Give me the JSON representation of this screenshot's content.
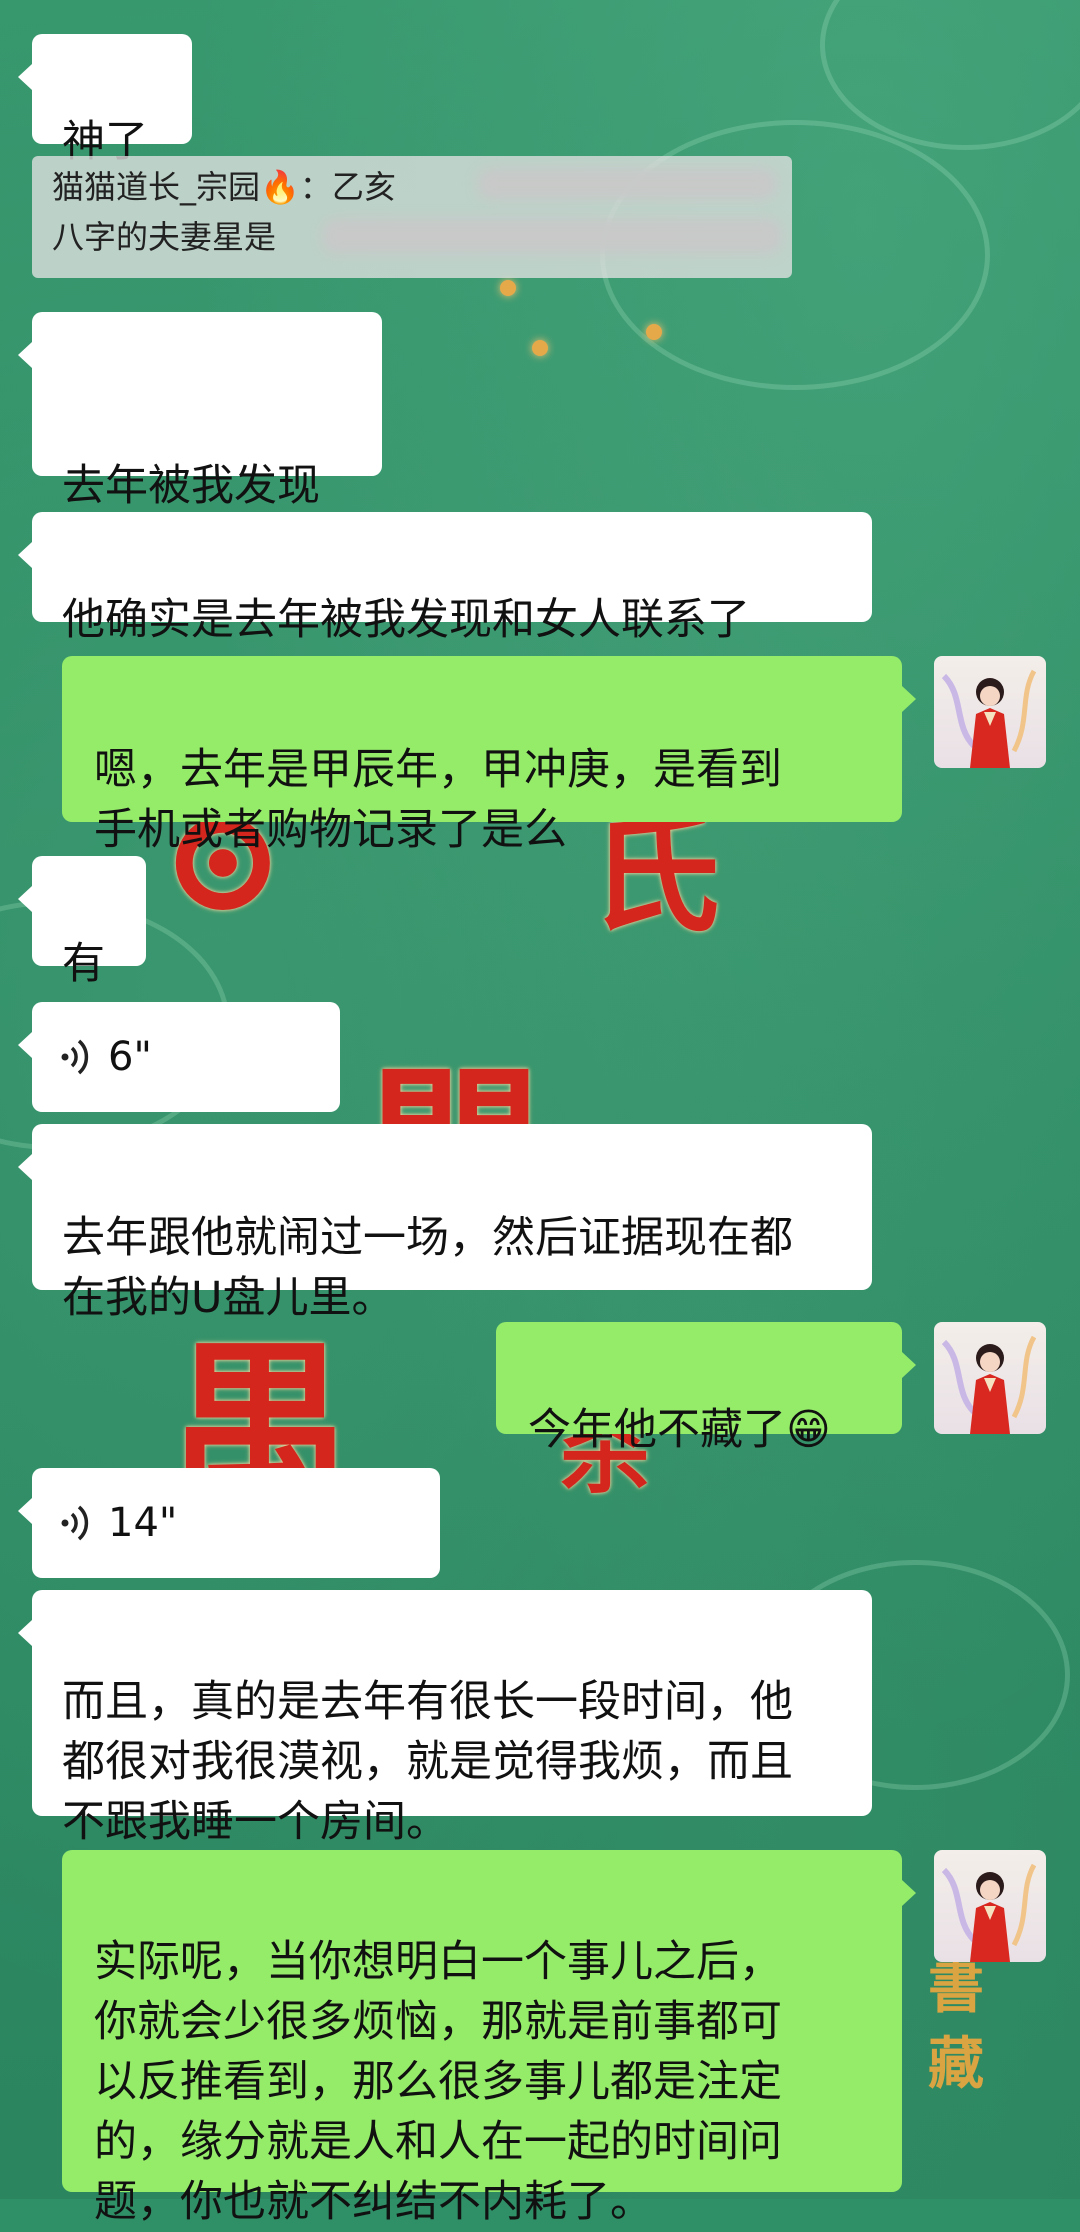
{
  "messages": [
    {
      "side": "left",
      "text": "神了"
    },
    {
      "quote_text": "猫猫道长_宗园🔥：乙亥 \n八字的夫妻星是"
    },
    {
      "side": "left",
      "text": "去年被我发现"
    },
    {
      "side": "left",
      "text": "他确实是去年被我发现和女人联系了"
    },
    {
      "side": "right",
      "text": "嗯，去年是甲辰年，甲冲庚，是看到\n手机或者购物记录了是么"
    },
    {
      "side": "left",
      "text": "有"
    },
    {
      "side": "left",
      "voice_duration": "6\""
    },
    {
      "side": "left",
      "text": "去年跟他就闹过一场，然后证据现在都\n在我的U盘儿里。"
    },
    {
      "side": "right",
      "text": "今年他不藏了😁"
    },
    {
      "side": "left",
      "voice_duration": "14\""
    },
    {
      "side": "left",
      "text": "而且，真的是去年有很长一段时间，他\n都很对我很漠视，就是觉得我烦，而且\n不跟我睡一个房间。"
    },
    {
      "side": "right",
      "text": "实际呢，当你想明白一个事儿之后，\n你就会少很多烦恼，那就是前事都可\n以反推看到，那么很多事儿都是注定\n的，缘分就是人和人在一起的时间问\n题，你也就不纠结不内耗了。"
    }
  ],
  "background": {
    "corner_text": "書\n藏"
  },
  "colors": {
    "self_bubble": "#95ec69",
    "other_bubble": "#ffffff",
    "chat_bg": "#2f8f66"
  },
  "icons": {
    "voice": "voice-wave-icon",
    "avatar": "avatar-image"
  }
}
